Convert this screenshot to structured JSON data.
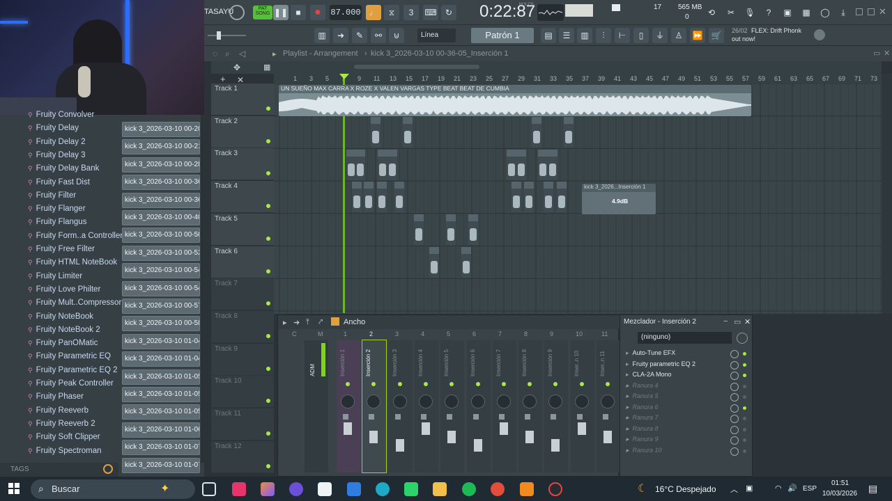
{
  "toolbar": {
    "brand_fragment": "TASAYU",
    "pattern_mode_label": "PAT",
    "song_mode_label": "SONG",
    "tempo": "87.000",
    "time_display": "0:22:87",
    "time_sub": "M:S:CS",
    "time_sub_right": "",
    "cpu_count": "17",
    "memory": "565 MB",
    "memory_sub": "0",
    "snap_label": "Línea",
    "pattern_label": "Patrón 1",
    "news_date": "26/02",
    "news_text": "FLEX: Drift Phonk",
    "news_sub": "out now!"
  },
  "playlist": {
    "title": "Playlist - Arrangement",
    "file_name": "kick 3_2026-03-10 00-36-05_Inserción 1",
    "ruler": [
      "1",
      "3",
      "5",
      "7",
      "9",
      "11",
      "13",
      "15",
      "17",
      "19",
      "21",
      "23",
      "25",
      "27",
      "29",
      "31",
      "33",
      "35",
      "37",
      "39",
      "41",
      "43",
      "45",
      "47",
      "49",
      "51",
      "53",
      "55",
      "57",
      "59",
      "61",
      "63",
      "65",
      "67",
      "69",
      "71",
      "73",
      "75"
    ],
    "tracks": [
      "Track 1",
      "Track 2",
      "Track 3",
      "Track 4",
      "Track 5",
      "Track 6",
      "Track 7",
      "Track 8",
      "Track 9",
      "Track 10",
      "Track 11",
      "Track 12"
    ],
    "main_clip_title": "UN SUEÑO MAX CARRA X ROZE X VALEN VARGAS TYPE BEAT  BEAT DE CUMBIA",
    "selected_clip_title": "kick 3_2026...Inserción 1",
    "selected_clip_gain": "4.9dB"
  },
  "browser": {
    "plugins": [
      "Fruity Convolver",
      "Fruity Delay",
      "Fruity Delay 2",
      "Fruity Delay 3",
      "Fruity Delay Bank",
      "Fruity Fast Dist",
      "Fruity Filter",
      "Fruity Flanger",
      "Fruity Flangus",
      "Fruity Form..a Controller",
      "Fruity Free Filter",
      "Fruity HTML NoteBook",
      "Fruity Limiter",
      "Fruity Love Philter",
      "Fruity Mult..Compressor",
      "Fruity NoteBook",
      "Fruity NoteBook 2",
      "Fruity PanOMatic",
      "Fruity Parametric EQ",
      "Fruity Parametric EQ 2",
      "Fruity Peak Controller",
      "Fruity Phaser",
      "Fruity Reeverb",
      "Fruity Reeverb 2",
      "Fruity Soft Clipper",
      "Fruity Spectroman"
    ],
    "files": [
      "kick 3_2026-03-10 00-20...",
      "kick 3_2026-03-10 00-21...",
      "kick 3_2026-03-10 00-28...",
      "kick 3_2026-03-10 00-36...",
      "kick 3_2026-03-10 00-36...",
      "kick 3_2026-03-10 00-40...",
      "kick 3_2026-03-10 00-50...",
      "kick 3_2026-03-10 00-52...",
      "kick 3_2026-03-10 00-54...",
      "kick 3_2026-03-10 00-54...",
      "kick 3_2026-03-10 00-57...",
      "kick 3_2026-03-10 00-58...",
      "kick 3_2026-03-10 01-04...",
      "kick 3_2026-03-10 01-04...",
      "kick 3_2026-03-10 01-05...",
      "kick 3_2026-03-10 01-05...",
      "kick 3_2026-03-10 01-05...",
      "kick 3_2026-03-10 01-06...",
      "kick 3_2026-03-10 01-07...",
      "kick 3_2026-03-10 01-07..."
    ],
    "tags_label": "TAGS"
  },
  "mixer": {
    "toolbar_label": "Ancho",
    "channel_numbers": [
      "C",
      "M",
      "1",
      "2",
      "3",
      "4",
      "5",
      "6",
      "7",
      "8",
      "9",
      "10",
      "11"
    ],
    "channels": [
      "Inserción 1",
      "Inserción 2",
      "Inserción 3",
      "Inserción 4",
      "Inserción 5",
      "Inserción 6",
      "Inserción 7",
      "Inserción 8",
      "Inserción 9",
      "Inser..n 10",
      "Inser..n 11"
    ],
    "master_label": "ADM"
  },
  "mixer_panel": {
    "title": "Mezclador - Inserción 2",
    "routing": "(ninguno)",
    "slots": [
      "Auto-Tune EFX",
      "Fruity parametric EQ 2",
      "CLA-2A Mono",
      "Ranura 4",
      "Ranura 5",
      "Ranura 6",
      "Ranura 7",
      "Ranura 8",
      "Ranura 9",
      "Ranura 10"
    ]
  },
  "taskbar": {
    "search_placeholder": "Buscar",
    "weather": "16°C Despejado",
    "language": "ESP",
    "time": "01:51",
    "date": "10/03/2026"
  }
}
